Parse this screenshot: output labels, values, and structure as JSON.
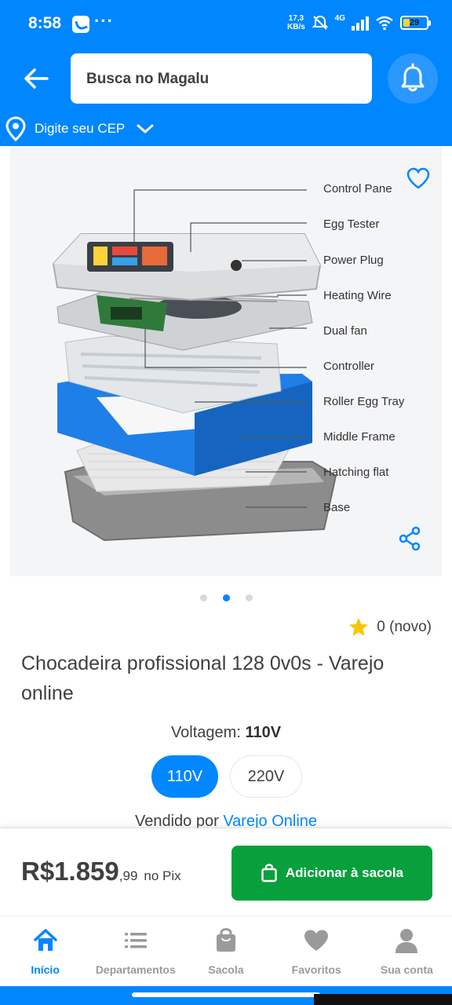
{
  "status_bar": {
    "time": "8:58",
    "more": "···",
    "speed_value": "17,3",
    "speed_unit": "KB/s",
    "network": "4G",
    "battery": "29"
  },
  "header": {
    "search_placeholder": "Busca no Magalu",
    "cep_label": "Digite seu CEP",
    "background_color": "#0086ff"
  },
  "gallery": {
    "labels": [
      "Control Pane",
      "Egg Tester",
      "Power Plug",
      "Heating Wire",
      "Dual fan",
      "Controller",
      "Roller Egg Tray",
      "Middle Frame",
      "Hatching flat",
      "Base"
    ],
    "page_count": 3,
    "active_page": 2
  },
  "rating": {
    "text": "0 (novo)",
    "star_color": "#f6c600"
  },
  "product": {
    "title": "Chocadeira profissional 128 0v0s - Varejo online",
    "voltage_label": "Voltagem:",
    "voltage_selected": "110V",
    "voltage_options": [
      "110V",
      "220V"
    ],
    "seller_prefix": "Vendido por",
    "seller_name": "Varejo Online"
  },
  "buy_bar": {
    "price_main": "R$1.859",
    "price_cents": ",99",
    "price_suffix": "no Pix",
    "add_button": "Adicionar à sacola",
    "button_color": "#08a03c"
  },
  "nav": {
    "items": [
      {
        "label": "Início",
        "icon": "home-icon",
        "active": true
      },
      {
        "label": "Departamentos",
        "icon": "menu-list-icon",
        "active": false
      },
      {
        "label": "Sacola",
        "icon": "bag-icon",
        "active": false
      },
      {
        "label": "Favoritos",
        "icon": "heart-icon",
        "active": false
      },
      {
        "label": "Sua conta",
        "icon": "user-icon",
        "active": false
      }
    ]
  }
}
